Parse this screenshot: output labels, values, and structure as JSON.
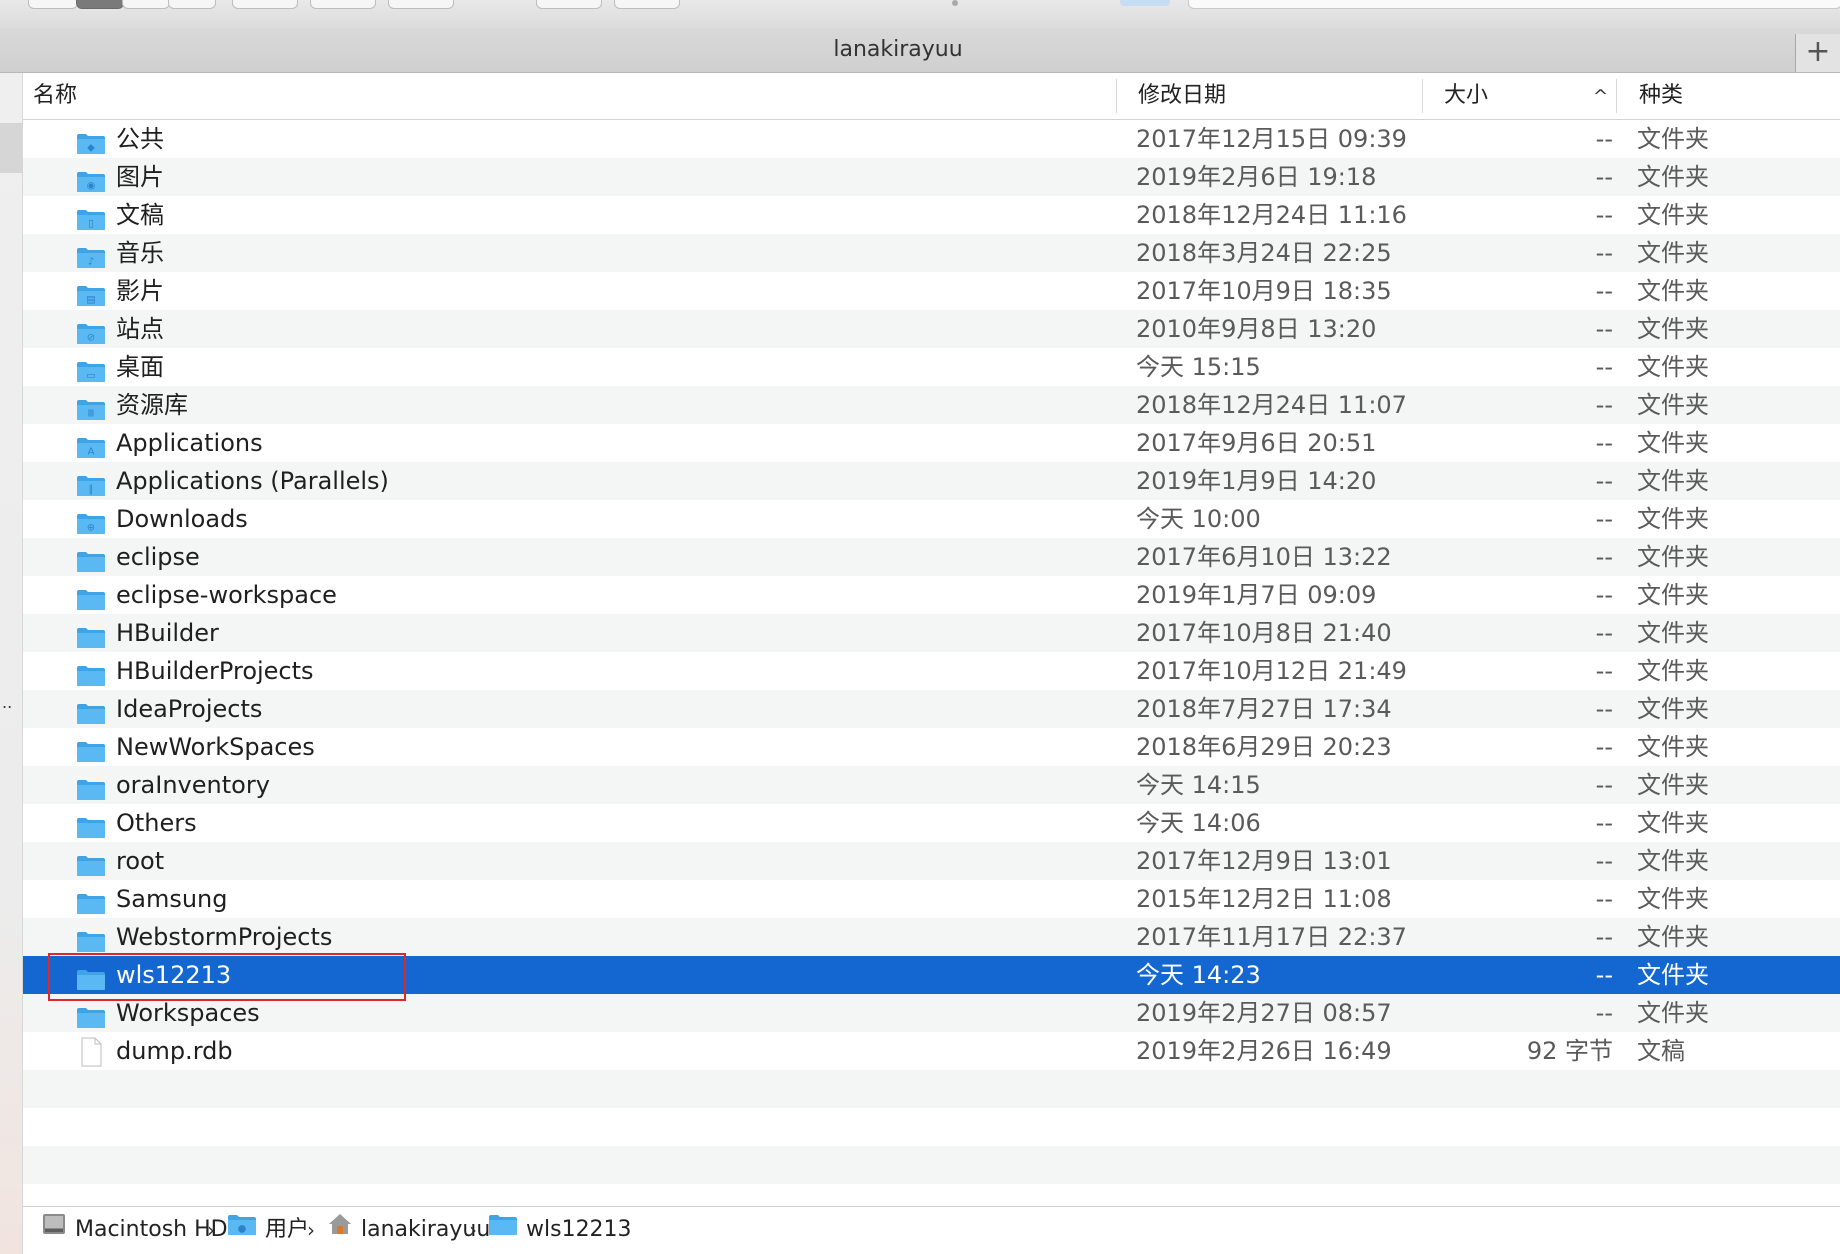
{
  "window": {
    "title": "lanakirayuu",
    "add_tab_symbol": "+"
  },
  "columns": {
    "name": "名称",
    "modified": "修改日期",
    "size": "大小",
    "kind": "种类",
    "sort_indicator": "^"
  },
  "files": [
    {
      "name": "公共",
      "date": "2017年12月15日 09:39",
      "size": "--",
      "kind": "文件夹",
      "icon": "public-folder-icon"
    },
    {
      "name": "图片",
      "date": "2019年2月6日 19:18",
      "size": "--",
      "kind": "文件夹",
      "icon": "pictures-folder-icon"
    },
    {
      "name": "文稿",
      "date": "2018年12月24日 11:16",
      "size": "--",
      "kind": "文件夹",
      "icon": "documents-folder-icon"
    },
    {
      "name": "音乐",
      "date": "2018年3月24日 22:25",
      "size": "--",
      "kind": "文件夹",
      "icon": "music-folder-icon"
    },
    {
      "name": "影片",
      "date": "2017年10月9日 18:35",
      "size": "--",
      "kind": "文件夹",
      "icon": "movies-folder-icon"
    },
    {
      "name": "站点",
      "date": "2010年9月8日 13:20",
      "size": "--",
      "kind": "文件夹",
      "icon": "sites-folder-icon"
    },
    {
      "name": "桌面",
      "date": "今天 15:15",
      "size": "--",
      "kind": "文件夹",
      "icon": "desktop-folder-icon"
    },
    {
      "name": "资源库",
      "date": "2018年12月24日 11:07",
      "size": "--",
      "kind": "文件夹",
      "icon": "library-folder-icon"
    },
    {
      "name": "Applications",
      "date": "2017年9月6日 20:51",
      "size": "--",
      "kind": "文件夹",
      "icon": "applications-folder-icon"
    },
    {
      "name": "Applications (Parallels)",
      "date": "2019年1月9日 14:20",
      "size": "--",
      "kind": "文件夹",
      "icon": "parallels-folder-icon"
    },
    {
      "name": "Downloads",
      "date": "今天 10:00",
      "size": "--",
      "kind": "文件夹",
      "icon": "downloads-folder-icon"
    },
    {
      "name": "eclipse",
      "date": "2017年6月10日 13:22",
      "size": "--",
      "kind": "文件夹",
      "icon": "folder-icon"
    },
    {
      "name": "eclipse-workspace",
      "date": "2019年1月7日 09:09",
      "size": "--",
      "kind": "文件夹",
      "icon": "folder-icon"
    },
    {
      "name": "HBuilder",
      "date": "2017年10月8日 21:40",
      "size": "--",
      "kind": "文件夹",
      "icon": "folder-icon"
    },
    {
      "name": "HBuilderProjects",
      "date": "2017年10月12日 21:49",
      "size": "--",
      "kind": "文件夹",
      "icon": "folder-icon"
    },
    {
      "name": "IdeaProjects",
      "date": "2018年7月27日 17:34",
      "size": "--",
      "kind": "文件夹",
      "icon": "folder-icon"
    },
    {
      "name": "NewWorkSpaces",
      "date": "2018年6月29日 20:23",
      "size": "--",
      "kind": "文件夹",
      "icon": "folder-icon"
    },
    {
      "name": "oraInventory",
      "date": "今天 14:15",
      "size": "--",
      "kind": "文件夹",
      "icon": "folder-icon"
    },
    {
      "name": "Others",
      "date": "今天 14:06",
      "size": "--",
      "kind": "文件夹",
      "icon": "folder-icon"
    },
    {
      "name": "root",
      "date": "2017年12月9日 13:01",
      "size": "--",
      "kind": "文件夹",
      "icon": "folder-icon"
    },
    {
      "name": "Samsung",
      "date": "2015年12月2日 11:08",
      "size": "--",
      "kind": "文件夹",
      "icon": "folder-icon"
    },
    {
      "name": "WebstormProjects",
      "date": "2017年11月17日 22:37",
      "size": "--",
      "kind": "文件夹",
      "icon": "folder-icon"
    },
    {
      "name": "wls12213",
      "date": "今天 14:23",
      "size": "--",
      "kind": "文件夹",
      "icon": "folder-icon",
      "selected": true
    },
    {
      "name": "Workspaces",
      "date": "2019年2月27日 08:57",
      "size": "--",
      "kind": "文件夹",
      "icon": "folder-icon"
    },
    {
      "name": "dump.rdb",
      "date": "2019年2月26日 16:49",
      "size": "92 字节",
      "kind": "文稿",
      "icon": "document-file-icon"
    }
  ],
  "pathbar": [
    {
      "label": "Macintosh HD",
      "icon": "hard-drive-icon"
    },
    {
      "label": "用户",
      "icon": "users-folder-icon"
    },
    {
      "label": "lanakirayuu",
      "icon": "home-icon"
    },
    {
      "label": "wls12213",
      "icon": "folder-icon"
    }
  ],
  "pathbar_separator": "›",
  "colors": {
    "selection": "#1467d0",
    "folder": "#5ab8f2",
    "annotation": "#e0262a"
  }
}
